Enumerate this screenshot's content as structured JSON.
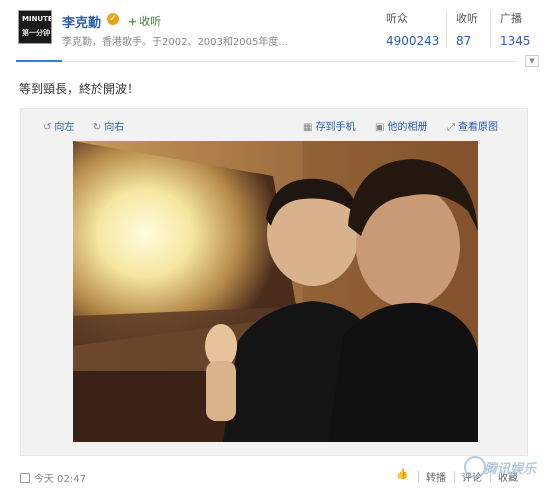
{
  "profile": {
    "avatar_text_top": "MINUTE",
    "avatar_text_bottom": "第一分钟",
    "name": "李克勤",
    "follow_label": "收听",
    "description": "李克勤，香港歌手。于2002、2003和2005年度...",
    "stats": [
      {
        "label": "听众",
        "value": "4900243"
      },
      {
        "label": "收听",
        "value": "87"
      },
      {
        "label": "广播",
        "value": "1345"
      }
    ]
  },
  "post": {
    "text": "等到頸長，終於開波！"
  },
  "image_toolbar": {
    "rotate_left": "向左",
    "rotate_right": "向右",
    "save_to_phone": "存到手机",
    "his_album": "他的相册",
    "view_original": "查看原图"
  },
  "footer": {
    "timestamp": "今天 02:47",
    "actions": [
      {
        "label": "转播"
      },
      {
        "label": "评论"
      },
      {
        "label": "收藏"
      }
    ]
  },
  "watermark": "腾讯娱乐",
  "colors": {
    "link": "#2a5db0",
    "accent_bar": "#2f7ed8",
    "panel_bg": "#f2f2f2"
  }
}
